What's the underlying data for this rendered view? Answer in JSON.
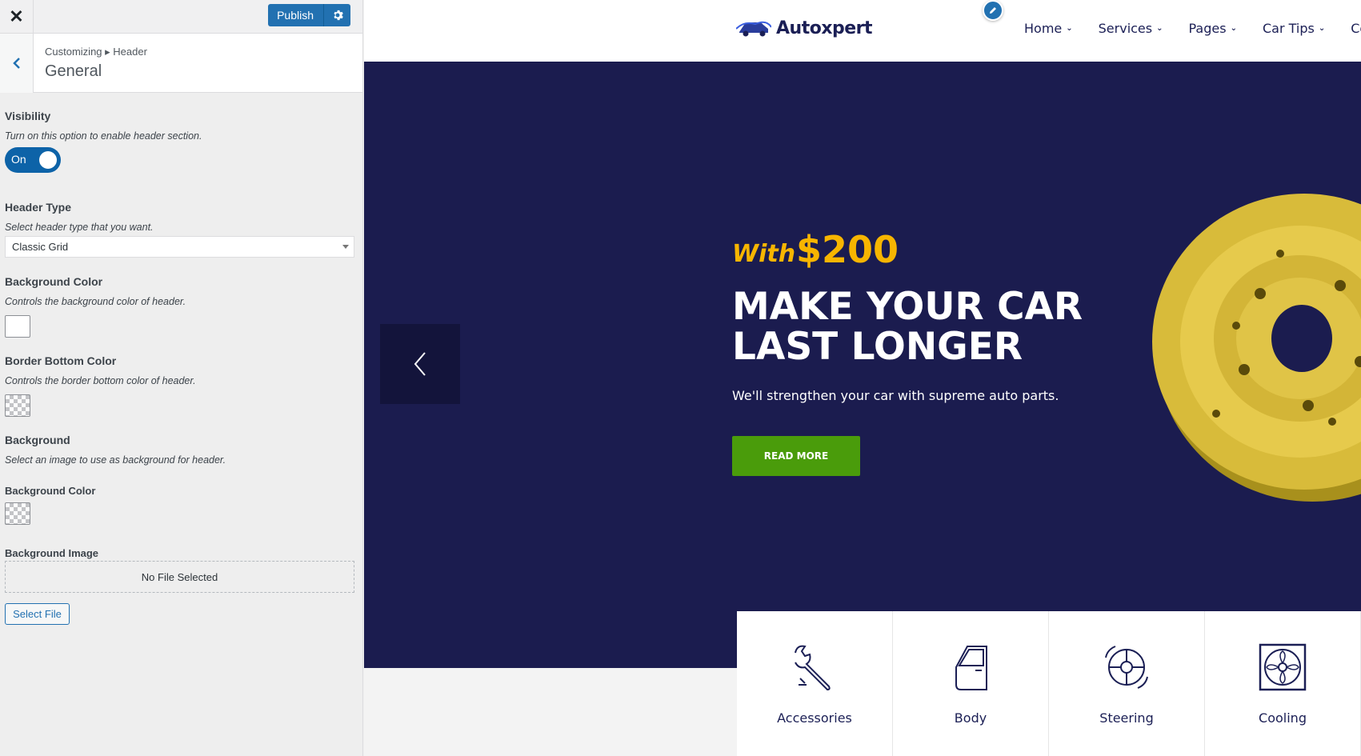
{
  "customizer": {
    "publish_label": "Publish",
    "breadcrumb": "Customizing ▸ Header",
    "section_title": "General",
    "visibility": {
      "title": "Visibility",
      "description": "Turn on this option to enable header section.",
      "toggle_label": "On"
    },
    "header_type": {
      "title": "Header Type",
      "description": "Select header type that you want.",
      "selected": "Classic Grid"
    },
    "background_color": {
      "title": "Background Color",
      "description": "Controls the background color of header."
    },
    "border_bottom_color": {
      "title": "Border Bottom Color",
      "description": "Controls the border bottom color of header."
    },
    "background": {
      "title": "Background",
      "description": "Select an image to use as background for header."
    },
    "background_color_2": {
      "title": "Background Color"
    },
    "background_image": {
      "title": "Background Image",
      "placeholder": "No File Selected",
      "button_label": "Select File"
    }
  },
  "site": {
    "logo_text": "Autoxpert",
    "nav": [
      {
        "label": "Home"
      },
      {
        "label": "Services"
      },
      {
        "label": "Pages"
      },
      {
        "label": "Car Tips"
      },
      {
        "label": "Con"
      }
    ],
    "hero": {
      "with": "With",
      "price": "$200",
      "title": "MAKE YOUR CAR LAST LONGER",
      "subtitle": "We'll strengthen your car with supreme auto parts.",
      "button": "READ MORE"
    },
    "categories": [
      {
        "label": "Accessories",
        "icon": "wrench-icon"
      },
      {
        "label": "Body",
        "icon": "car-door-icon"
      },
      {
        "label": "Steering",
        "icon": "steering-wheel-icon"
      },
      {
        "label": "Cooling",
        "icon": "radiator-fan-icon"
      }
    ]
  },
  "colors": {
    "accent": "#2271b1",
    "hero_bg": "#1b1c4f",
    "price": "#f7b500",
    "button_green": "#4a9c0b"
  }
}
